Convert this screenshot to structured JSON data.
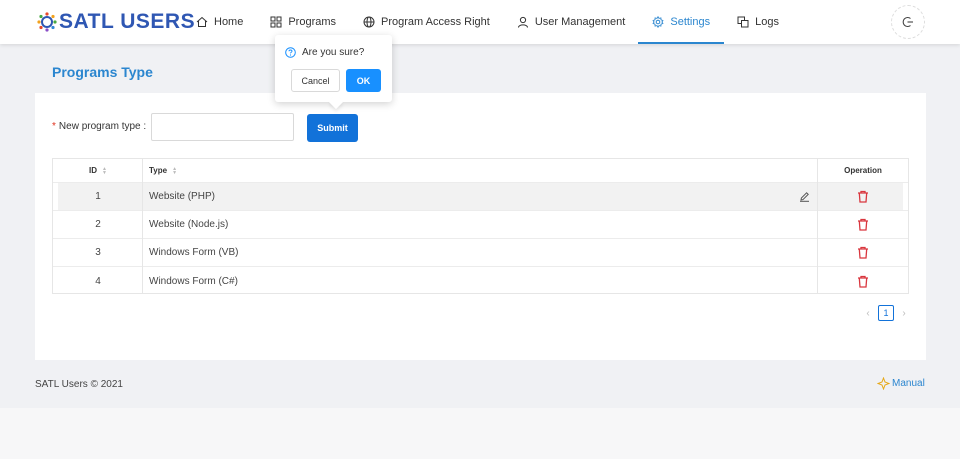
{
  "app": {
    "logo_text": "SATL USERS"
  },
  "nav": [
    {
      "label": "Home",
      "icon": "home-icon"
    },
    {
      "label": "Programs",
      "icon": "grid-icon"
    },
    {
      "label": "Program Access Right",
      "icon": "globe-icon"
    },
    {
      "label": "User Management",
      "icon": "user-icon"
    },
    {
      "label": "Settings",
      "icon": "gear-icon",
      "active": true
    },
    {
      "label": "Logs",
      "icon": "copy-icon"
    }
  ],
  "page": {
    "title": "Programs Type"
  },
  "form": {
    "label": "New program type :",
    "required_mark": "*",
    "input_value": "",
    "submit_label": "Submit"
  },
  "table": {
    "columns": [
      "ID",
      "Type",
      "Operation"
    ],
    "rows": [
      {
        "id": "1",
        "type": "Website (PHP)"
      },
      {
        "id": "2",
        "type": "Website (Node.js)"
      },
      {
        "id": "3",
        "type": "Windows Form (VB)"
      },
      {
        "id": "4",
        "type": "Windows Form (C#)"
      }
    ]
  },
  "pagination": {
    "current_page": "1",
    "prev": "‹",
    "next": "›"
  },
  "popconfirm": {
    "message": "Are you sure?",
    "cancel_label": "Cancel",
    "ok_label": "OK"
  },
  "footer": {
    "copyright": "SATL Users © 2021",
    "manual_label": "Manual"
  },
  "colors": {
    "accent": "#2b86cf",
    "primary_button": "#1272d9",
    "danger": "#d9363e",
    "logo": "#2f57b3"
  }
}
